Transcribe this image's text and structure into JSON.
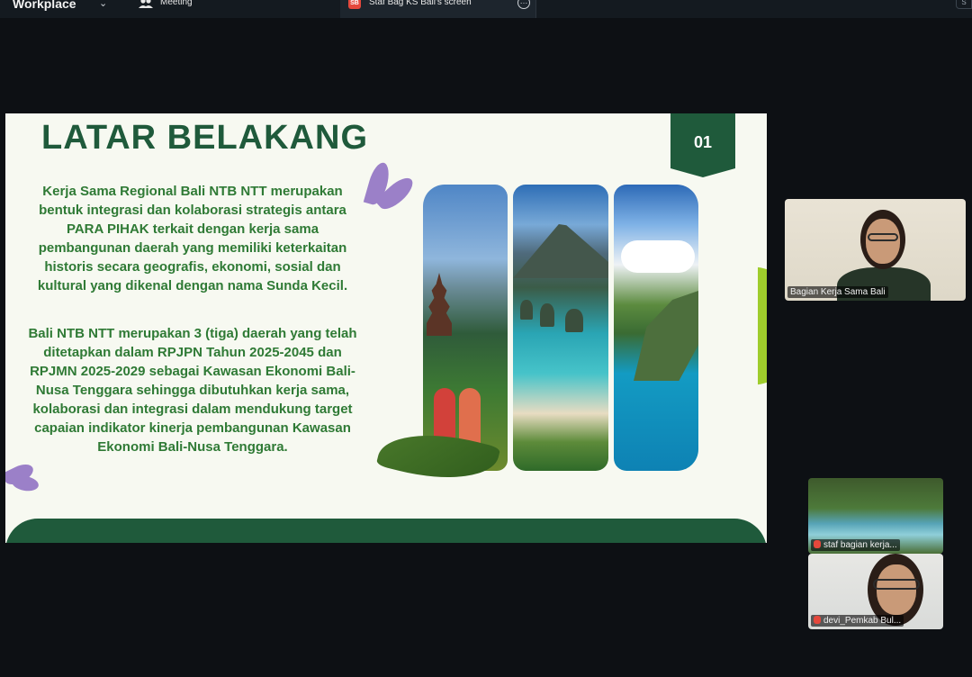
{
  "topbar": {
    "brand": "Workplace",
    "brand_chevron": "⌄",
    "meeting_label": "Meeting",
    "share_badge": "SB",
    "share_label": "Staf Bag KS Bali's screen",
    "more_glyph": "…",
    "corner_glyph": "S"
  },
  "slide": {
    "title": "LATAR BELAKANG",
    "number": "01",
    "paragraph_1": "Kerja Sama Regional Bali NTB NTT merupakan bentuk integrasi dan kolaborasi strategis antara PARA PIHAK terkait dengan kerja sama pembangunan daerah yang memiliki keterkaitan historis secara geografis, ekonomi, sosial dan kultural yang dikenal dengan nama Sunda Kecil.",
    "paragraph_2": "Bali NTB NTT merupakan 3 (tiga) daerah yang telah ditetapkan dalam RPJPN Tahun 2025-2045 dan RPJMN 2025-2029 sebagai Kawasan Ekonomi Bali-Nusa Tenggara sehingga dibutuhkan kerja sama, kolaborasi dan integrasi dalam mendukung target capaian indikator kinerja pembangunan Kawasan Ekonomi Bali-Nusa Tenggara.",
    "colors": {
      "title": "#1f5a3b",
      "body": "#2f7a35",
      "accent_lime": "#9fcd2c",
      "background": "#f7f9f1"
    }
  },
  "participants": [
    {
      "name": "Bagian Kerja Sama Bali",
      "muted": false
    },
    {
      "name": "staf bagian kerja...",
      "muted": true
    },
    {
      "name": "devi_Pemkab Bul...",
      "muted": true
    }
  ],
  "icons": {
    "meeting": "people-icon",
    "more": "more-icon",
    "mic_off": "mic-off-icon"
  }
}
